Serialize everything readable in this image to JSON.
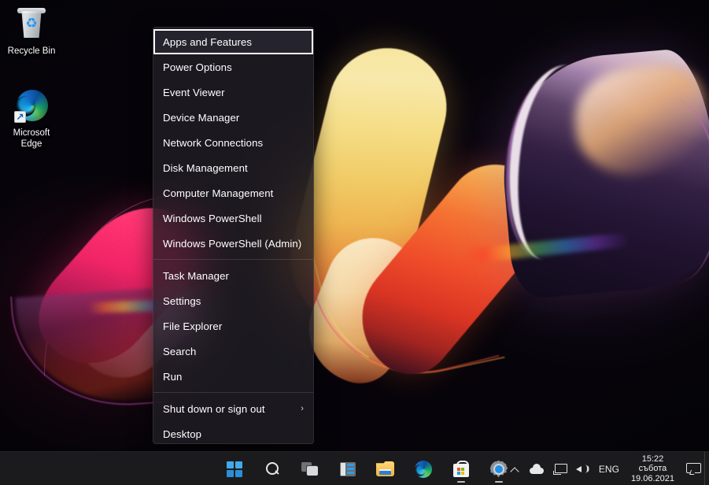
{
  "desktop": {
    "icons": [
      {
        "name": "recycle-bin",
        "label": "Recycle Bin",
        "icon": "recycle-bin-icon"
      },
      {
        "name": "microsoft-edge",
        "label": "Microsoft\nEdge",
        "label_line1": "Microsoft",
        "label_line2": "Edge",
        "icon": "edge-icon",
        "shortcut": true
      }
    ]
  },
  "winx_menu": {
    "focused_item": "Apps and Features",
    "items": [
      {
        "label": "Apps and Features",
        "focused": true
      },
      {
        "label": "Power Options"
      },
      {
        "label": "Event Viewer"
      },
      {
        "label": "Device Manager"
      },
      {
        "label": "Network Connections"
      },
      {
        "label": "Disk Management"
      },
      {
        "label": "Computer Management"
      },
      {
        "label": "Windows PowerShell"
      },
      {
        "label": "Windows PowerShell (Admin)"
      },
      {
        "separator": true
      },
      {
        "label": "Task Manager"
      },
      {
        "label": "Settings"
      },
      {
        "label": "File Explorer"
      },
      {
        "label": "Search"
      },
      {
        "label": "Run"
      },
      {
        "separator": true
      },
      {
        "label": "Shut down or sign out",
        "submenu": true,
        "chevron": "›"
      },
      {
        "label": "Desktop"
      }
    ]
  },
  "taskbar": {
    "buttons": [
      {
        "name": "start-button",
        "icon": "windows-logo-icon",
        "label": "Start",
        "running": false
      },
      {
        "name": "search-button",
        "icon": "search-icon",
        "label": "Search",
        "running": false
      },
      {
        "name": "task-view-button",
        "icon": "task-view-icon",
        "label": "Task View",
        "running": false
      },
      {
        "name": "widgets-button",
        "icon": "widgets-icon",
        "label": "Widgets",
        "running": false
      },
      {
        "name": "file-explorer-button",
        "icon": "folder-icon",
        "label": "File Explorer",
        "running": false
      },
      {
        "name": "edge-button",
        "icon": "edge-icon",
        "label": "Microsoft Edge",
        "running": false
      },
      {
        "name": "store-button",
        "icon": "microsoft-store-icon",
        "label": "Microsoft Store",
        "running": true
      },
      {
        "name": "settings-button",
        "icon": "gear-icon",
        "label": "Settings",
        "running": true
      }
    ],
    "tray": {
      "chevron": "show-hidden-icons-icon",
      "onedrive": "cloud-icon",
      "network": "network-icon",
      "volume": "volume-icon",
      "language": "ENG",
      "clock": {
        "time": "15:22",
        "weekday": "събота",
        "date": "19.06.2021"
      },
      "notifications": "notification-icon"
    }
  },
  "colors": {
    "accent": "#2f9de6",
    "taskbar_bg": "#1c1c1e",
    "menu_bg": "rgba(32,30,38,0.80)",
    "menu_text": "#ffffff",
    "focus_outline": "#ffffff"
  }
}
